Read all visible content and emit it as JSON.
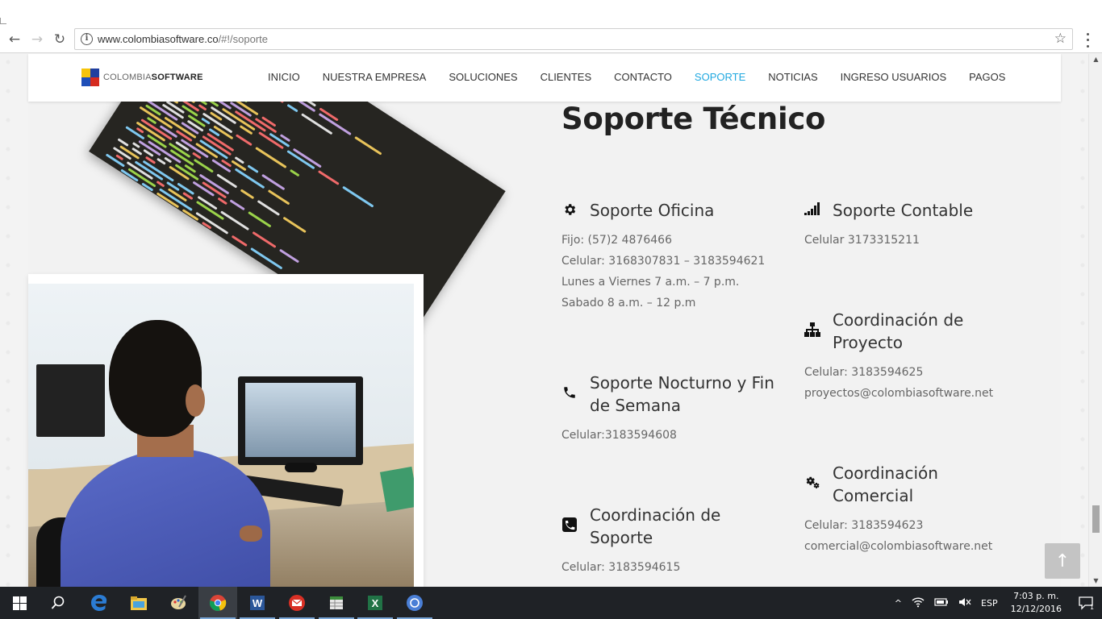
{
  "browser": {
    "url_domain": "www.colombiasoftware.co",
    "url_path": "/#!/soporte",
    "back_glyph": "←",
    "forward_glyph": "→",
    "reload_glyph": "↻",
    "info_glyph": "i",
    "star_glyph": "☆"
  },
  "site": {
    "logo": {
      "part1": "COLOMBIA",
      "part2": "SOFTWARE"
    },
    "nav": [
      {
        "label": "INICIO"
      },
      {
        "label": "NUESTRA EMPRESA"
      },
      {
        "label": "SOLUCIONES"
      },
      {
        "label": "CLIENTES"
      },
      {
        "label": "CONTACTO"
      },
      {
        "label": "SOPORTE",
        "active": true
      },
      {
        "label": "NOTICIAS"
      },
      {
        "label": "INGRESO USUARIOS"
      },
      {
        "label": "PAGOS"
      }
    ],
    "accent_color": "#1fa8e0"
  },
  "page": {
    "title": "Soporte Técnico",
    "blocks": {
      "oficina": {
        "icon": "gear-icon",
        "heading": "Soporte Oficina",
        "lines": [
          "Fijo: (57)2 4876466",
          "Celular: 3168307831 – 3183594621",
          "Lunes a Viernes 7 a.m. –   7 p.m.",
          "Sabado 8 a.m. – 12 p.m"
        ]
      },
      "contable": {
        "icon": "signal-bars-icon",
        "heading": "Soporte Contable",
        "lines": [
          "Celular 3173315211"
        ]
      },
      "proyecto": {
        "icon": "sitemap-icon",
        "heading_line1": "Coordinación de",
        "heading_line2": "Proyecto",
        "lines": [
          "Celular: 3183594625",
          "proyectos@colombiasoftware.net"
        ]
      },
      "nocturno": {
        "icon": "phone-icon",
        "heading_line1": "Soporte Nocturno y Fin",
        "heading_line2": "de Semana",
        "lines": [
          "Celular:3183594608"
        ]
      },
      "comercial": {
        "icon": "gears-icon",
        "heading_line1": "Coordinación",
        "heading_line2": "Comercial",
        "lines": [
          "Celular: 3183594623",
          "comercial@colombiasoftware.net"
        ]
      },
      "coord_soporte": {
        "icon": "phone-square-icon",
        "heading_line1": "Coordinación de",
        "heading_line2": "Soporte",
        "lines": [
          "Celular: 3183594615"
        ]
      }
    },
    "back_to_top_glyph": "↑"
  },
  "taskbar": {
    "apps": [
      "start",
      "search",
      "edge",
      "file-explorer",
      "paint",
      "chrome",
      "word",
      "mail",
      "sheets",
      "excel",
      "chrome-alt"
    ],
    "tray": {
      "chevron": "^",
      "language": "ESP",
      "time": "7:03 p. m.",
      "date": "12/12/2016",
      "notification_count": "1"
    }
  }
}
